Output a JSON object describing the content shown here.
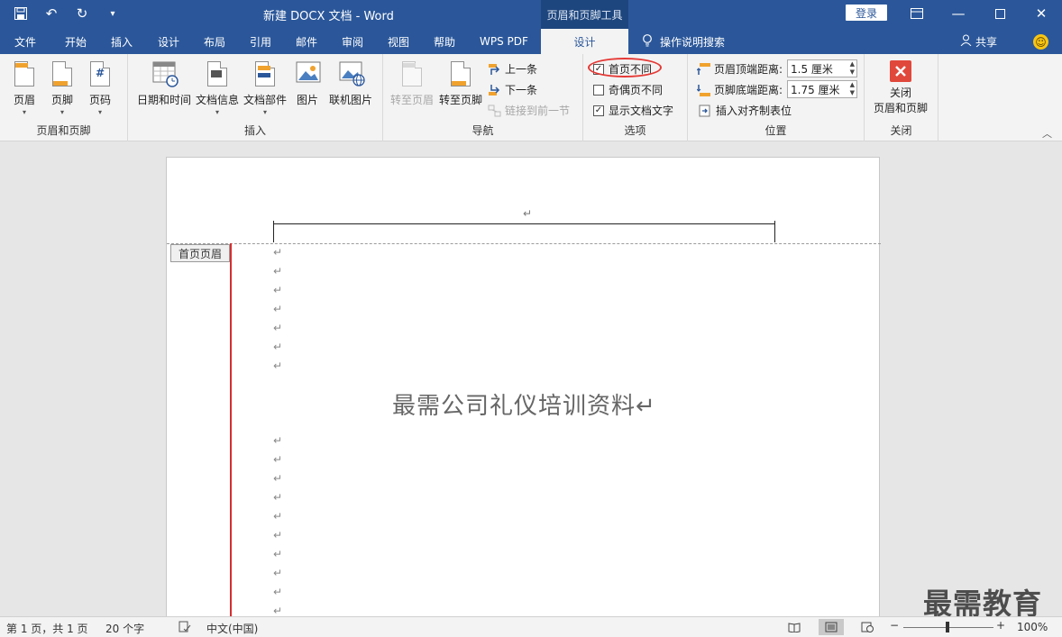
{
  "titlebar": {
    "doc_title": "新建 DOCX 文档  -  Word",
    "context_tool": "页眉和页脚工具",
    "login": "登录"
  },
  "tabs": [
    "文件",
    "开始",
    "插入",
    "设计",
    "布局",
    "引用",
    "邮件",
    "审阅",
    "视图",
    "帮助",
    "WPS PDF"
  ],
  "active_tab": "设计",
  "search_label": "操作说明搜索",
  "share_label": "共享",
  "ribbon": {
    "group_hf": {
      "label": "页眉和页脚",
      "header": "页眉",
      "footer": "页脚",
      "page_number": "页码"
    },
    "group_insert": {
      "label": "插入",
      "datetime": "日期和时间",
      "docinfo": "文档信息",
      "parts": "文档部件",
      "picture": "图片",
      "online_picture": "联机图片"
    },
    "group_nav": {
      "label": "导航",
      "goto_header": "转至页眉",
      "goto_footer": "转至页脚",
      "prev": "上一条",
      "next": "下一条",
      "link_prev": "链接到前一节"
    },
    "group_options": {
      "label": "选项",
      "diff_first": "首页不同",
      "diff_odd_even": "奇偶页不同",
      "show_text": "显示文档文字",
      "diff_first_checked": true,
      "diff_odd_even_checked": false,
      "show_text_checked": true
    },
    "group_position": {
      "label": "位置",
      "header_top_label": "页眉顶端距离:",
      "header_top_value": "1.5 厘米",
      "footer_bottom_label": "页脚底端距离:",
      "footer_bottom_value": "1.75 厘米",
      "insert_tab": "插入对齐制表位"
    },
    "group_close": {
      "label": "关闭",
      "close_btn_line1": "关闭",
      "close_btn_line2": "页眉和页脚"
    }
  },
  "document": {
    "header_tag": "首页页眉",
    "heading": "最需公司礼仪培训资料↵",
    "para_mark": "↵"
  },
  "watermark": "最需教育",
  "statusbar": {
    "page": "第 1 页，共 1 页",
    "words": "20 个字",
    "language": "中文(中国)",
    "zoom": "100%"
  },
  "colors": {
    "brand": "#2b579a",
    "highlight_circle": "#e53935",
    "close_icon": "#e0483b",
    "header_icon_band": "#f0a22e"
  }
}
